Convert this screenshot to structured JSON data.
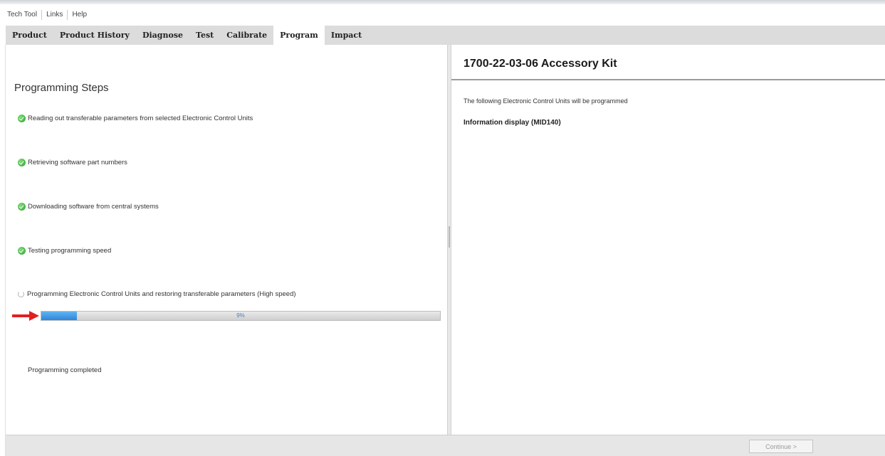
{
  "menu": [
    "Tech Tool",
    "Links",
    "Help"
  ],
  "tabs": [
    {
      "label": "Product",
      "active": false
    },
    {
      "label": "Product History",
      "active": false
    },
    {
      "label": "Diagnose",
      "active": false
    },
    {
      "label": "Test",
      "active": false
    },
    {
      "label": "Calibrate",
      "active": false
    },
    {
      "label": "Program",
      "active": true
    },
    {
      "label": "Impact",
      "active": false
    }
  ],
  "left": {
    "title": "Programming Steps",
    "steps": [
      {
        "label": "Reading out transferable parameters from selected Electronic Control Units",
        "status": "done",
        "icon": "check-icon"
      },
      {
        "label": "Retrieving software part numbers",
        "status": "done",
        "icon": "check-icon"
      },
      {
        "label": "Downloading software from central systems",
        "status": "done",
        "icon": "check-icon"
      },
      {
        "label": "Testing programming speed",
        "status": "done",
        "icon": "check-icon"
      },
      {
        "label": "Programming Electronic Control Units and restoring transferable parameters (High speed)",
        "status": "in-progress",
        "icon": "spinner-icon"
      }
    ],
    "progress": {
      "value": 0.09,
      "label": "9%"
    },
    "completed_text": "Programming completed"
  },
  "right": {
    "title": "1700-22-03-06 Accessory Kit",
    "intro": "The following Electronic Control Units will be programmed",
    "ecu": "Information display (MID140)"
  },
  "footer": {
    "continue_label": "Continue >",
    "continue_enabled": false
  },
  "colors": {
    "arrow": "#e02020",
    "progress_fill": "#3a92e0",
    "tab_bar": "#dcdcdc"
  }
}
